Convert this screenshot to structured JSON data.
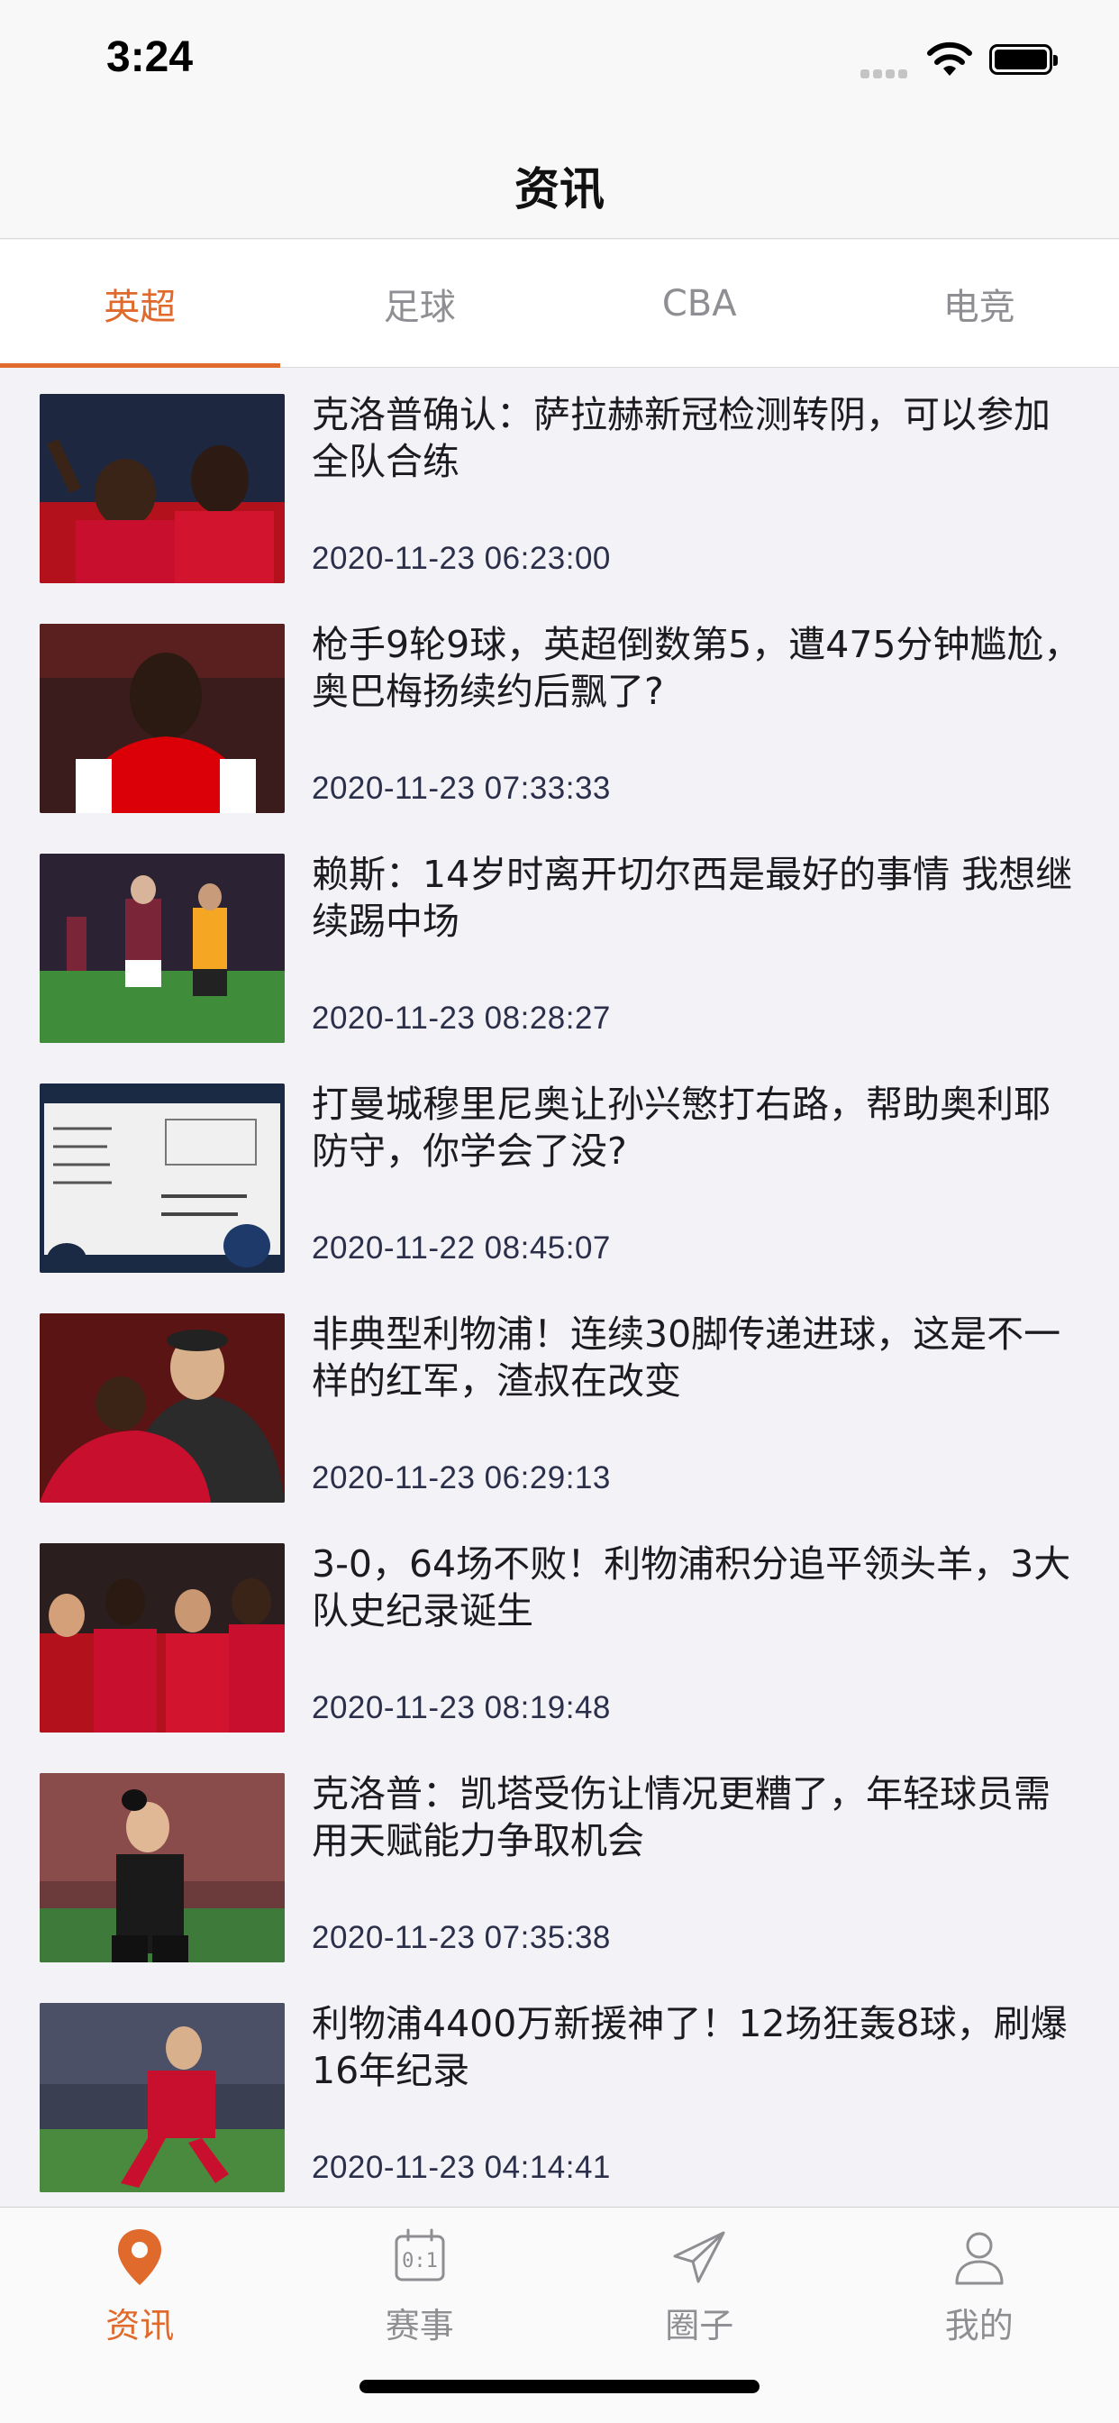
{
  "status_bar": {
    "time": "3:24"
  },
  "nav": {
    "title": "资讯"
  },
  "top_tabs": [
    {
      "label": "英超",
      "active": true
    },
    {
      "label": "足球",
      "active": false
    },
    {
      "label": "CBA",
      "active": false
    },
    {
      "label": "电竞",
      "active": false
    }
  ],
  "news": [
    {
      "title": "克洛普确认：萨拉赫新冠检测转阴，可以参加全队合练",
      "time": "2020-11-23 06:23:00"
    },
    {
      "title": "枪手9轮9球，英超倒数第5，遭475分钟尴尬，奥巴梅扬续约后飘了?",
      "time": "2020-11-23 07:33:33"
    },
    {
      "title": "赖斯：14岁时离开切尔西是最好的事情 我想继续踢中场",
      "time": "2020-11-23 08:28:27"
    },
    {
      "title": "打曼城穆里尼奥让孙兴慜打右路，帮助奥利耶防守，你学会了没?",
      "time": "2020-11-22 08:45:07"
    },
    {
      "title": "非典型利物浦！连续30脚传递进球，这是不一样的红军，渣叔在改变",
      "time": "2020-11-23 06:29:13"
    },
    {
      "title": "3-0，64场不败！利物浦积分追平领头羊，3大队史纪录诞生",
      "time": "2020-11-23 08:19:48"
    },
    {
      "title": "克洛普：凯塔受伤让情况更糟了，年轻球员需用天赋能力争取机会",
      "time": "2020-11-23 07:35:38"
    },
    {
      "title": "利物浦4400万新援神了！12场狂轰8球，刷爆16年纪录",
      "time": "2020-11-23 04:14:41"
    }
  ],
  "bottom_tabs": [
    {
      "label": "资讯",
      "icon": "location-pin-icon",
      "active": true
    },
    {
      "label": "赛事",
      "icon": "scoreboard-icon",
      "active": false
    },
    {
      "label": "圈子",
      "icon": "paper-plane-icon",
      "active": false
    },
    {
      "label": "我的",
      "icon": "person-icon",
      "active": false
    }
  ],
  "colors": {
    "accent": "#e0692c",
    "inactive": "#8e8e93",
    "background": "#f2f2f7"
  }
}
